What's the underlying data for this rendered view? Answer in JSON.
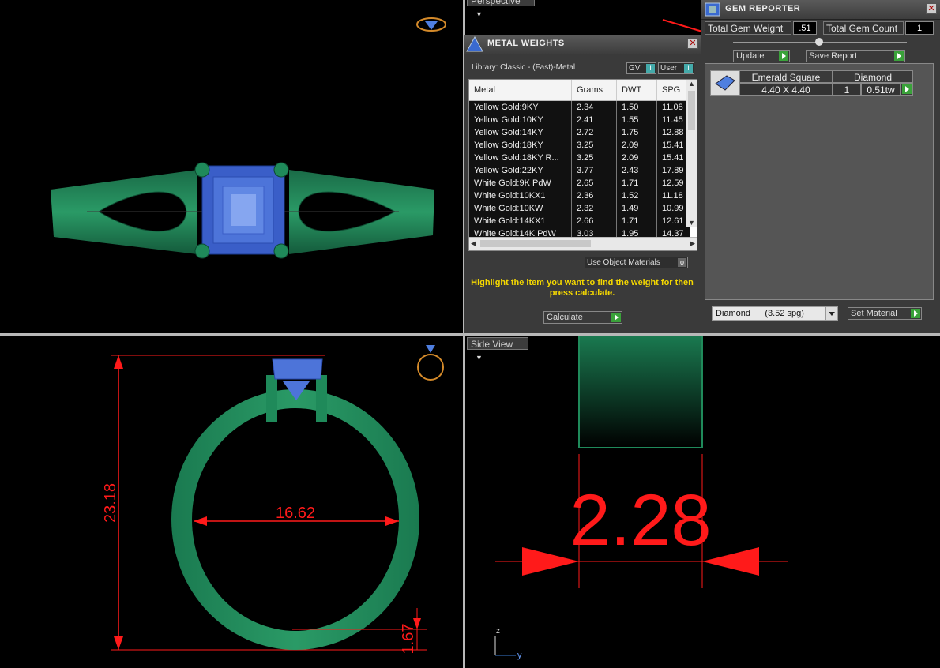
{
  "viewports": {
    "top_right_tab": "Perspective",
    "bottom_right_tab": "Side View"
  },
  "dimensions": {
    "height": "23.18",
    "inner_diameter": "16.62",
    "bottom_thickness": "1.67",
    "shank_width": "2.28"
  },
  "axis": {
    "z": "z",
    "y": "y"
  },
  "metal_weights": {
    "title": "METAL WEIGHTS",
    "library": "Library: Classic - (Fast)-Metal",
    "gv_label": "GV",
    "user_label": "User",
    "columns": [
      "Metal",
      "Grams",
      "DWT",
      "SPG"
    ],
    "rows": [
      [
        "Yellow Gold:9KY",
        "2.34",
        "1.50",
        "11.08"
      ],
      [
        "Yellow Gold:10KY",
        "2.41",
        "1.55",
        "11.45"
      ],
      [
        "Yellow Gold:14KY",
        "2.72",
        "1.75",
        "12.88"
      ],
      [
        "Yellow Gold:18KY",
        "3.25",
        "2.09",
        "15.41"
      ],
      [
        "Yellow Gold:18KY R...",
        "3.25",
        "2.09",
        "15.41"
      ],
      [
        "Yellow Gold:22KY",
        "3.77",
        "2.43",
        "17.89"
      ],
      [
        "White Gold:9K PdW",
        "2.65",
        "1.71",
        "12.59"
      ],
      [
        "White Gold:10KX1",
        "2.36",
        "1.52",
        "11.18"
      ],
      [
        "White Gold:10KW",
        "2.32",
        "1.49",
        "10.99"
      ],
      [
        "White Gold:14KX1",
        "2.66",
        "1.71",
        "12.61"
      ],
      [
        "White Gold:14K PdW",
        "3.03",
        "1.95",
        "14.37"
      ]
    ],
    "use_object_materials": "Use Object Materials",
    "hint": "Highlight the item you want to find the weight for then press calculate.",
    "calculate": "Calculate"
  },
  "gem_reporter": {
    "title": "GEM REPORTER",
    "total_weight_label": "Total Gem Weight",
    "total_weight_value": ".51",
    "total_count_label": "Total Gem Count",
    "total_count_value": "1",
    "update": "Update",
    "save_report": "Save Report",
    "gem": {
      "shape": "Emerald Square",
      "type": "Diamond",
      "size": "4.40 X 4.40",
      "count": "1",
      "weight": "0.51tw"
    },
    "material_select": "Diamond      (3.52 spg)",
    "set_material": "Set Material"
  },
  "colors": {
    "ring": "#1f8a5a",
    "gem": "#5577dd",
    "dimension": "#ff1a1a",
    "hint": "#f5d800"
  }
}
